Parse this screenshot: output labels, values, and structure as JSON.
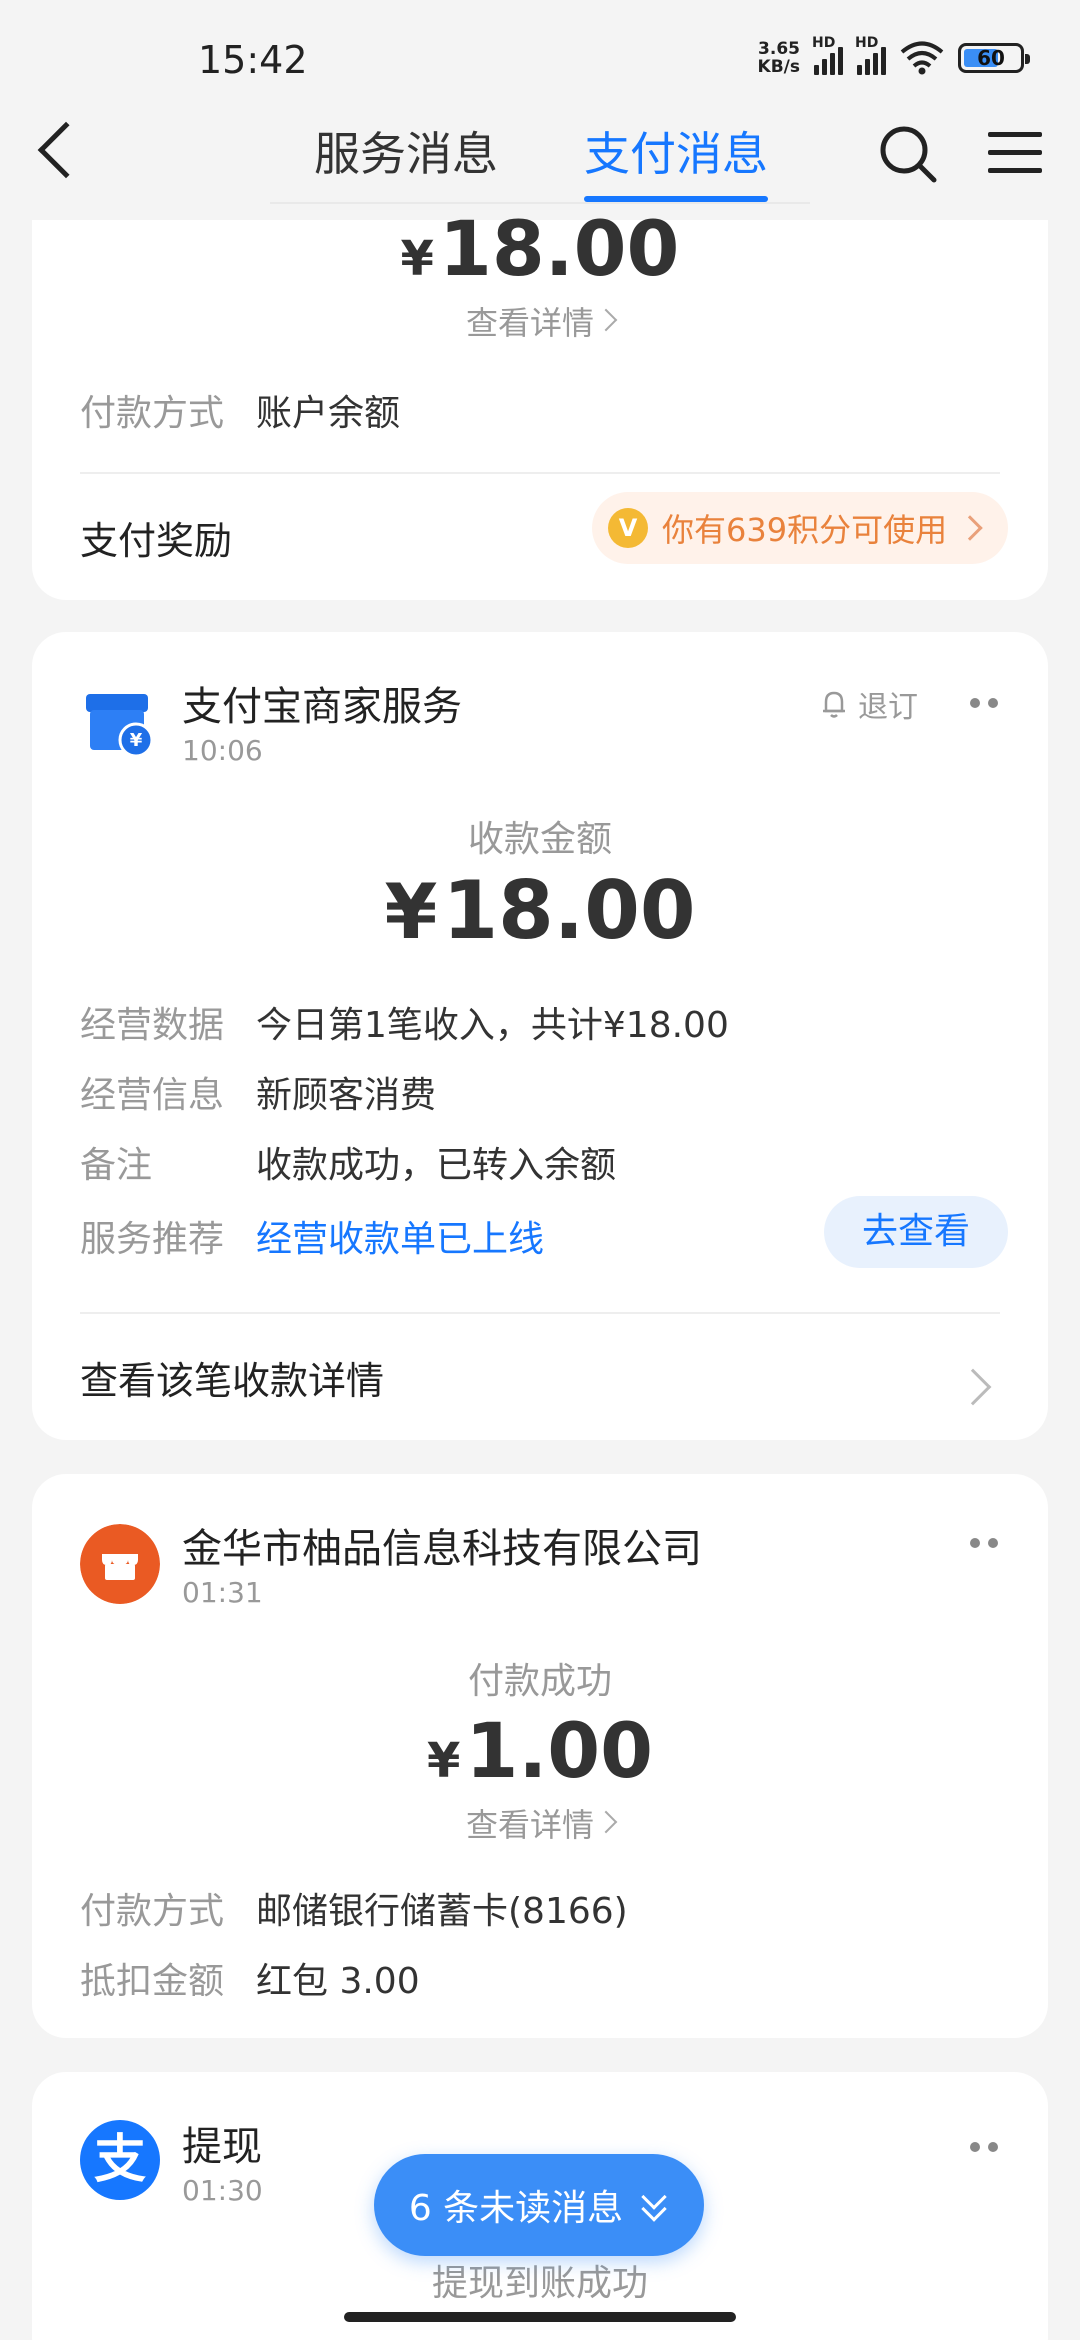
{
  "status_bar": {
    "time": "15:42",
    "net_speed_value": "3.65",
    "net_speed_unit": "KB/s",
    "sim1_label": "HD",
    "sim2_label": "HD",
    "battery": "60"
  },
  "nav": {
    "tab_service": "服务消息",
    "tab_pay": "支付消息",
    "active_tab": "支付消息"
  },
  "card1": {
    "currency": "¥",
    "amount": "18.00",
    "detail_link": "查看详情",
    "pay_method_label": "付款方式",
    "pay_method_value": "账户余额",
    "reward_title": "支付奖励",
    "reward_badge_icon": "coin-icon",
    "reward_coin_glyph": "V",
    "reward_text": "你有639积分可使用"
  },
  "card2": {
    "merchant_name": "支付宝商家服务",
    "time": "10:06",
    "unsubscribe": "退订",
    "amount_title": "收款金额",
    "currency": "¥",
    "amount": "18.00",
    "rows": [
      {
        "label": "经营数据",
        "value": "今日第1笔收入，共计¥18.00"
      },
      {
        "label": "经营信息",
        "value": "新顾客消费"
      },
      {
        "label": "备注",
        "value": "收款成功，已转入余额"
      },
      {
        "label": "服务推荐",
        "value": "经营收款单已上线"
      }
    ],
    "go_button": "去查看",
    "footer_link": "查看该笔收款详情"
  },
  "card3": {
    "merchant_name": "金华市柚品信息科技有限公司",
    "time": "01:31",
    "status_title": "付款成功",
    "currency": "¥",
    "amount": "1.00",
    "detail_link": "查看详情",
    "rows": [
      {
        "label": "付款方式",
        "value": "邮储银行储蓄卡(8166)"
      },
      {
        "label": "抵扣金额",
        "value": "红包 3.00"
      }
    ]
  },
  "card4": {
    "merchant_name": "提现",
    "time": "01:30",
    "logo_glyph": "支",
    "status_title": "提现到账成功"
  },
  "unread_button": "6 条未读消息",
  "colors": {
    "accent": "#1677ff",
    "reward_orange": "#e9823c",
    "background": "#f4f4f4"
  }
}
